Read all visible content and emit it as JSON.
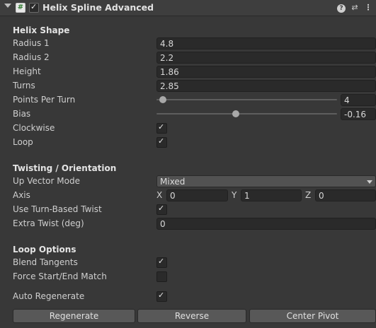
{
  "header": {
    "title": "Helix Spline Advanced",
    "script_glyph": "#"
  },
  "icons": {
    "help": "help-icon",
    "presets": "presets-icon",
    "menu": "kebab-menu-icon"
  },
  "sections": {
    "shape": "Helix Shape",
    "twist": "Twisting / Orientation",
    "loop": "Loop Options"
  },
  "shape": {
    "radius1": {
      "label": "Radius 1",
      "value": "4.8"
    },
    "radius2": {
      "label": "Radius 2",
      "value": "2.2"
    },
    "height": {
      "label": "Height",
      "value": "1.86"
    },
    "turns": {
      "label": "Turns",
      "value": "2.85"
    },
    "points": {
      "label": "Points Per Turn",
      "value": "4",
      "slider_fraction": 0.0
    },
    "bias": {
      "label": "Bias",
      "value": "-0.16",
      "slider_fraction": 0.42
    },
    "clockwise": {
      "label": "Clockwise",
      "checked": true
    },
    "loop": {
      "label": "Loop",
      "checked": true
    }
  },
  "twist": {
    "up_mode": {
      "label": "Up Vector Mode",
      "value": "Mixed"
    },
    "axis": {
      "label": "Axis",
      "x_label": "X",
      "x": "0",
      "y_label": "Y",
      "y": "1",
      "z_label": "Z",
      "z": "0"
    },
    "turn_based": {
      "label": "Use Turn-Based Twist",
      "checked": true
    },
    "extra": {
      "label": "Extra Twist (deg)",
      "value": "0"
    }
  },
  "loop": {
    "blend": {
      "label": "Blend Tangents",
      "checked": true
    },
    "force": {
      "label": "Force Start/End Match",
      "checked": false
    }
  },
  "auto_regen": {
    "label": "Auto Regenerate",
    "checked": true
  },
  "buttons": {
    "regenerate": "Regenerate",
    "reverse": "Reverse",
    "center_pivot": "Center Pivot"
  }
}
